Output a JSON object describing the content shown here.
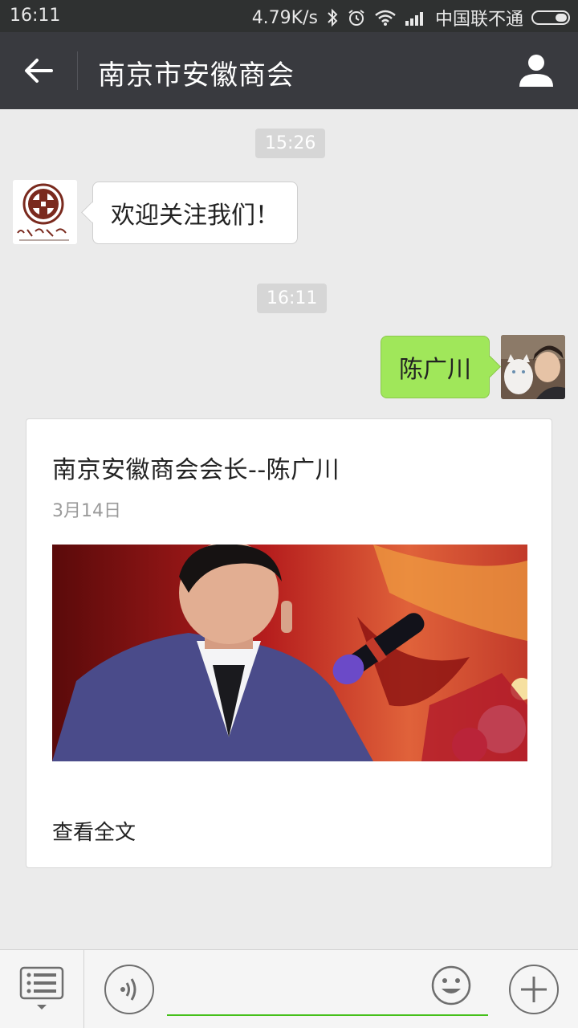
{
  "status_bar": {
    "time": "16:11",
    "speed": "4.79K/s",
    "carrier": "中国联不通"
  },
  "header": {
    "title": "南京市安徽商会",
    "back_icon": "arrow-left-icon",
    "profile_icon": "person-icon"
  },
  "messages": [
    {
      "type": "time",
      "text": "15:26"
    },
    {
      "type": "incoming",
      "text": "欢迎关注我们！"
    },
    {
      "type": "time",
      "text": "16:11"
    },
    {
      "type": "outgoing",
      "text": "陈广川"
    }
  ],
  "article": {
    "title": "南京安徽商会会长--陈广川",
    "date": "3月14日",
    "read_more": "查看全文"
  },
  "input_bar": {
    "menu_icon": "menu-list-icon",
    "voice_icon": "voice-icon",
    "emoji_icon": "emoji-icon",
    "plus_icon": "plus-icon",
    "accent": "#45c01a"
  }
}
